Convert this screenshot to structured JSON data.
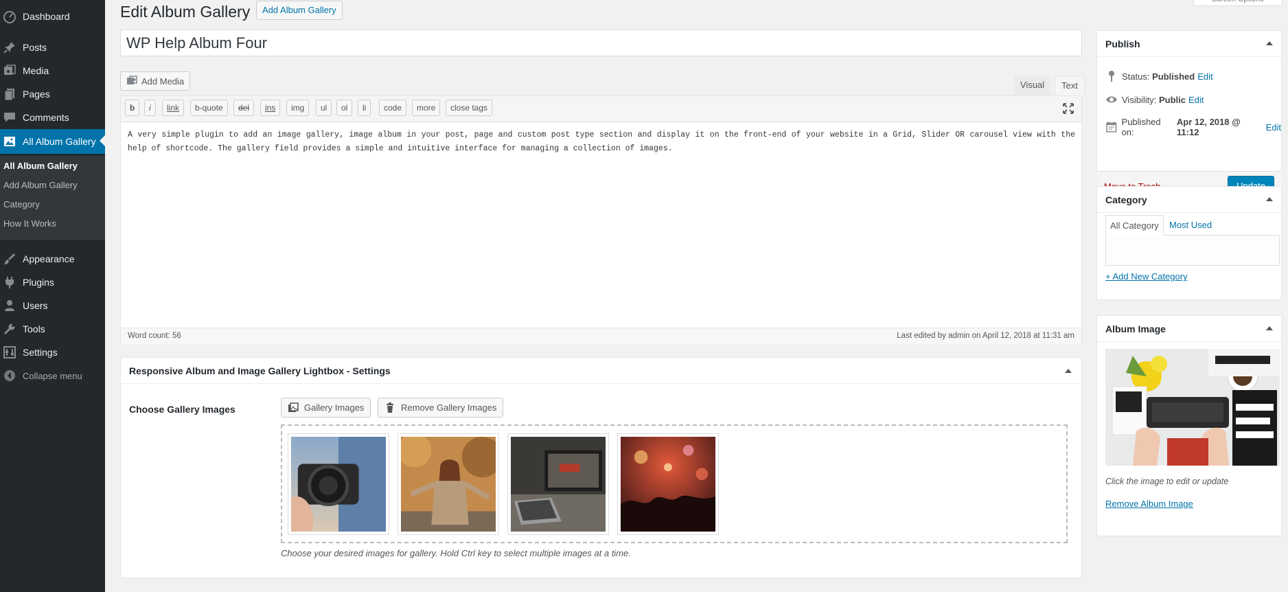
{
  "sidebar": {
    "items": [
      {
        "label": "Dashboard",
        "icon": "dashboard-icon"
      },
      {
        "label": "Posts",
        "icon": "pin-icon"
      },
      {
        "label": "Media",
        "icon": "media-icon"
      },
      {
        "label": "Pages",
        "icon": "pages-icon"
      },
      {
        "label": "Comments",
        "icon": "comments-icon"
      },
      {
        "label": "All Album Gallery",
        "icon": "gallery-icon",
        "current": true
      },
      {
        "label": "Appearance",
        "icon": "brush-icon"
      },
      {
        "label": "Plugins",
        "icon": "plugin-icon"
      },
      {
        "label": "Users",
        "icon": "users-icon"
      },
      {
        "label": "Tools",
        "icon": "wrench-icon"
      },
      {
        "label": "Settings",
        "icon": "settings-icon"
      },
      {
        "label": "Collapse menu",
        "icon": "collapse-icon"
      }
    ],
    "submenu": [
      "All Album Gallery",
      "Add Album Gallery",
      "Category",
      "How It Works"
    ]
  },
  "header": {
    "title": "Edit Album Gallery",
    "add_new": "Add Album Gallery",
    "screen_options": "Screen Options"
  },
  "post": {
    "title": "WP Help Album Four"
  },
  "editor": {
    "add_media": "Add Media",
    "tabs": {
      "visual": "Visual",
      "text": "Text"
    },
    "toolbar": [
      "b",
      "i",
      "link",
      "b-quote",
      "del",
      "ins",
      "img",
      "ul",
      "ol",
      "li",
      "code",
      "more",
      "close tags"
    ],
    "content": "A very simple plugin to add an image gallery, image album in your post, page and custom post type section and display it on the front-end of your website in a Grid, Slider OR carousel view with the help of shortcode. The gallery field provides a simple and intuitive interface for managing a collection of images.",
    "word_count": "Word count: 56",
    "last_edited": "Last edited by admin on April 12, 2018 at 11:31 am"
  },
  "settings": {
    "title": "Responsive Album and Image Gallery Lightbox - Settings",
    "choose_label": "Choose Gallery Images",
    "gallery_button": "Gallery Images",
    "remove_button": "Remove Gallery Images",
    "hint": "Choose your desired images for gallery. Hold Ctrl key to select multiple images at a time."
  },
  "publish": {
    "title": "Publish",
    "status_label": "Status:",
    "status_value": "Published",
    "visibility_label": "Visibility:",
    "visibility_value": "Public",
    "published_label": "Published on:",
    "published_value": "Apr 12, 2018 @ 11:12",
    "edit": "Edit",
    "trash": "Move to Trash",
    "update": "Update"
  },
  "category": {
    "title": "Category",
    "tab_all": "All Category",
    "tab_used": "Most Used",
    "add_new": "+ Add New Category"
  },
  "album_image": {
    "title": "Album Image",
    "hint": "Click the image to edit or update",
    "remove": "Remove Album Image"
  },
  "colors": {
    "sidebar": "#23282d",
    "accent": "#0073aa",
    "button_primary": "#0085ba",
    "trash": "#a00000"
  }
}
